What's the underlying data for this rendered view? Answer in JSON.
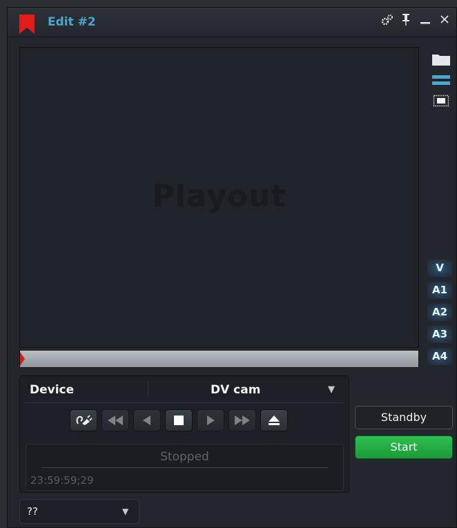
{
  "window": {
    "title": "Edit #2"
  },
  "titlebar_icons": [
    "gears-icon",
    "pin-icon",
    "minimize-icon",
    "close-icon"
  ],
  "viewer": {
    "watermark": "Playout"
  },
  "side_icons": [
    "folder-icon",
    "lines-icon",
    "frame-icon"
  ],
  "tracks": [
    "V",
    "A1",
    "A2",
    "A3",
    "A4"
  ],
  "device": {
    "label": "Device",
    "value": "DV cam"
  },
  "transport_icons": [
    "plug-icon",
    "rewind-icon",
    "step-back-icon",
    "stop-icon",
    "play-icon",
    "fast-forward-icon",
    "eject-icon"
  ],
  "status": {
    "text": "Stopped",
    "timecode": "23:59:59;29"
  },
  "buttons": {
    "standby": "Standby",
    "start": "Start"
  },
  "bottom_dropdown": {
    "value": "??"
  },
  "colors": {
    "accent": "#4aa7cf",
    "start": "#22ab43",
    "bookmark": "#e21b1b",
    "playhead": "#d41e1e"
  }
}
